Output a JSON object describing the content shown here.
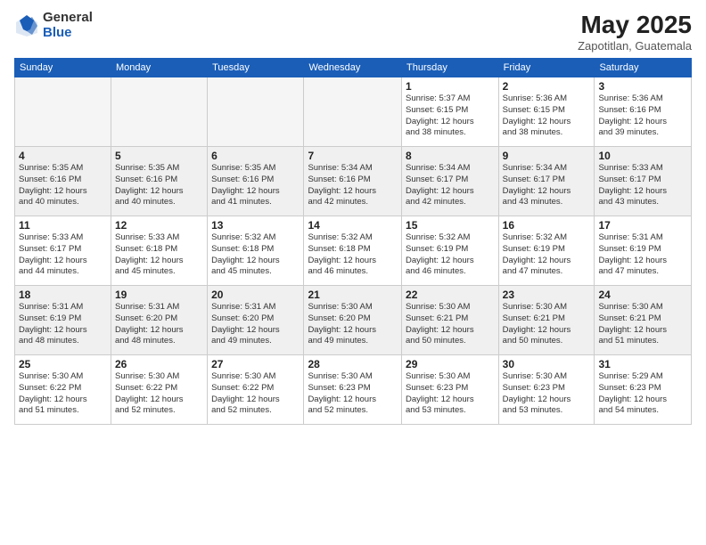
{
  "logo": {
    "general": "General",
    "blue": "Blue"
  },
  "header": {
    "title": "May 2025",
    "subtitle": "Zapotitlan, Guatemala"
  },
  "days_of_week": [
    "Sunday",
    "Monday",
    "Tuesday",
    "Wednesday",
    "Thursday",
    "Friday",
    "Saturday"
  ],
  "weeks": [
    [
      {
        "day": "",
        "info": ""
      },
      {
        "day": "",
        "info": ""
      },
      {
        "day": "",
        "info": ""
      },
      {
        "day": "",
        "info": ""
      },
      {
        "day": "1",
        "info": "Sunrise: 5:37 AM\nSunset: 6:15 PM\nDaylight: 12 hours\nand 38 minutes."
      },
      {
        "day": "2",
        "info": "Sunrise: 5:36 AM\nSunset: 6:15 PM\nDaylight: 12 hours\nand 38 minutes."
      },
      {
        "day": "3",
        "info": "Sunrise: 5:36 AM\nSunset: 6:16 PM\nDaylight: 12 hours\nand 39 minutes."
      }
    ],
    [
      {
        "day": "4",
        "info": "Sunrise: 5:35 AM\nSunset: 6:16 PM\nDaylight: 12 hours\nand 40 minutes."
      },
      {
        "day": "5",
        "info": "Sunrise: 5:35 AM\nSunset: 6:16 PM\nDaylight: 12 hours\nand 40 minutes."
      },
      {
        "day": "6",
        "info": "Sunrise: 5:35 AM\nSunset: 6:16 PM\nDaylight: 12 hours\nand 41 minutes."
      },
      {
        "day": "7",
        "info": "Sunrise: 5:34 AM\nSunset: 6:16 PM\nDaylight: 12 hours\nand 42 minutes."
      },
      {
        "day": "8",
        "info": "Sunrise: 5:34 AM\nSunset: 6:17 PM\nDaylight: 12 hours\nand 42 minutes."
      },
      {
        "day": "9",
        "info": "Sunrise: 5:34 AM\nSunset: 6:17 PM\nDaylight: 12 hours\nand 43 minutes."
      },
      {
        "day": "10",
        "info": "Sunrise: 5:33 AM\nSunset: 6:17 PM\nDaylight: 12 hours\nand 43 minutes."
      }
    ],
    [
      {
        "day": "11",
        "info": "Sunrise: 5:33 AM\nSunset: 6:17 PM\nDaylight: 12 hours\nand 44 minutes."
      },
      {
        "day": "12",
        "info": "Sunrise: 5:33 AM\nSunset: 6:18 PM\nDaylight: 12 hours\nand 45 minutes."
      },
      {
        "day": "13",
        "info": "Sunrise: 5:32 AM\nSunset: 6:18 PM\nDaylight: 12 hours\nand 45 minutes."
      },
      {
        "day": "14",
        "info": "Sunrise: 5:32 AM\nSunset: 6:18 PM\nDaylight: 12 hours\nand 46 minutes."
      },
      {
        "day": "15",
        "info": "Sunrise: 5:32 AM\nSunset: 6:19 PM\nDaylight: 12 hours\nand 46 minutes."
      },
      {
        "day": "16",
        "info": "Sunrise: 5:32 AM\nSunset: 6:19 PM\nDaylight: 12 hours\nand 47 minutes."
      },
      {
        "day": "17",
        "info": "Sunrise: 5:31 AM\nSunset: 6:19 PM\nDaylight: 12 hours\nand 47 minutes."
      }
    ],
    [
      {
        "day": "18",
        "info": "Sunrise: 5:31 AM\nSunset: 6:19 PM\nDaylight: 12 hours\nand 48 minutes."
      },
      {
        "day": "19",
        "info": "Sunrise: 5:31 AM\nSunset: 6:20 PM\nDaylight: 12 hours\nand 48 minutes."
      },
      {
        "day": "20",
        "info": "Sunrise: 5:31 AM\nSunset: 6:20 PM\nDaylight: 12 hours\nand 49 minutes."
      },
      {
        "day": "21",
        "info": "Sunrise: 5:30 AM\nSunset: 6:20 PM\nDaylight: 12 hours\nand 49 minutes."
      },
      {
        "day": "22",
        "info": "Sunrise: 5:30 AM\nSunset: 6:21 PM\nDaylight: 12 hours\nand 50 minutes."
      },
      {
        "day": "23",
        "info": "Sunrise: 5:30 AM\nSunset: 6:21 PM\nDaylight: 12 hours\nand 50 minutes."
      },
      {
        "day": "24",
        "info": "Sunrise: 5:30 AM\nSunset: 6:21 PM\nDaylight: 12 hours\nand 51 minutes."
      }
    ],
    [
      {
        "day": "25",
        "info": "Sunrise: 5:30 AM\nSunset: 6:22 PM\nDaylight: 12 hours\nand 51 minutes."
      },
      {
        "day": "26",
        "info": "Sunrise: 5:30 AM\nSunset: 6:22 PM\nDaylight: 12 hours\nand 52 minutes."
      },
      {
        "day": "27",
        "info": "Sunrise: 5:30 AM\nSunset: 6:22 PM\nDaylight: 12 hours\nand 52 minutes."
      },
      {
        "day": "28",
        "info": "Sunrise: 5:30 AM\nSunset: 6:23 PM\nDaylight: 12 hours\nand 52 minutes."
      },
      {
        "day": "29",
        "info": "Sunrise: 5:30 AM\nSunset: 6:23 PM\nDaylight: 12 hours\nand 53 minutes."
      },
      {
        "day": "30",
        "info": "Sunrise: 5:30 AM\nSunset: 6:23 PM\nDaylight: 12 hours\nand 53 minutes."
      },
      {
        "day": "31",
        "info": "Sunrise: 5:29 AM\nSunset: 6:23 PM\nDaylight: 12 hours\nand 54 minutes."
      }
    ]
  ]
}
